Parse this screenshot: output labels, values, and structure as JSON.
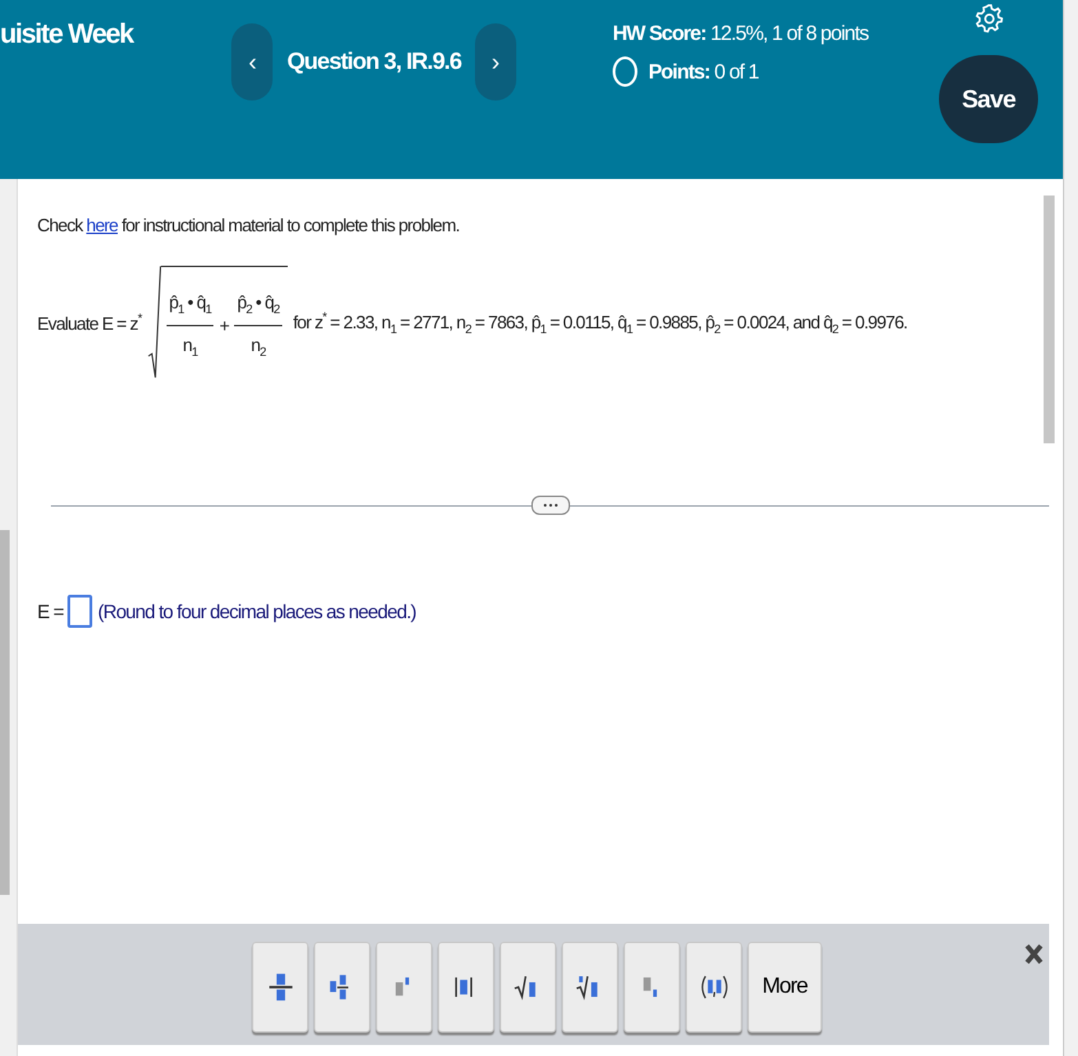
{
  "header": {
    "title": "uisite Week",
    "prev": "‹",
    "question": "Question 3, IR.9.6",
    "next": "›",
    "hw_score_label": "HW Score:",
    "hw_score": "12.5%, 1 of 8 points",
    "points_label": "Points:",
    "points": "0 of 1",
    "save": "Save"
  },
  "problem": {
    "check_prefix": "Check",
    "check_link": "here",
    "check_suffix": "for instructional material to complete this problem.",
    "evaluate": "Evaluate E = z$^{*}$",
    "fractions": [
      {
        "numerator": "p̂$_{1}$ • q̂$_{1}$",
        "denominator": "n$_{1}$"
      },
      {
        "numerator": "p̂$_{2}$ • q̂$_{2}$",
        "denominator": "n$_{2}$"
      }
    ],
    "plus": "+",
    "condition": "for z$^{*}$ = 2.33, n$_{1}$ = 2771, n$_{2}$ = 7863, p̂$_{1}$ = 0.0115, q̂$_{1}$ = 0.9885, p̂$_{2}$ = 0.0024, and q̂$_{2}$ = 0.9976."
  },
  "answer": {
    "label": "E =",
    "hint": "(Round to four decimal places as needed.)"
  },
  "toolbar": {
    "tools": [
      {
        "kind": "fraction"
      },
      {
        "kind": "mixed-number"
      },
      {
        "kind": "exponent"
      },
      {
        "kind": "absolute-value"
      },
      {
        "kind": "square-root"
      },
      {
        "kind": "nth-root"
      },
      {
        "kind": "subscript"
      },
      {
        "kind": "ordered-pair"
      }
    ],
    "more": "More"
  }
}
